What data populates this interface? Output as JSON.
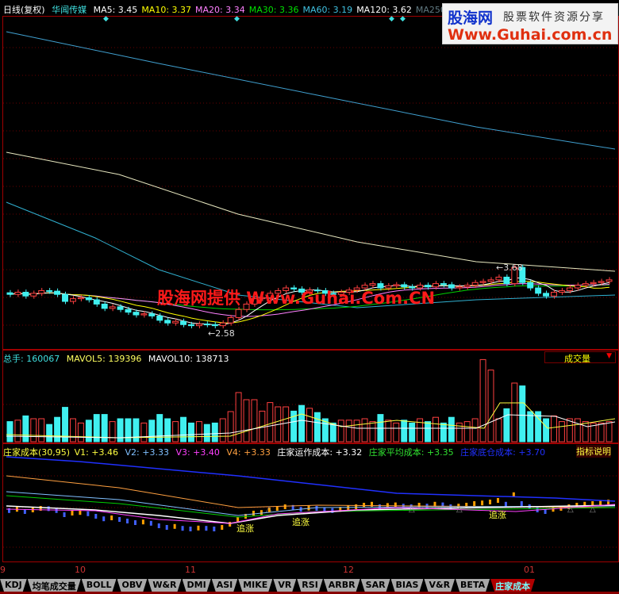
{
  "header": {
    "period": "日线(复权)",
    "stock": "华闻传媒",
    "ma": [
      {
        "label": "MA5: 3.45",
        "color": "#ffffff"
      },
      {
        "label": "MA10: 3.37",
        "color": "#ffff00"
      },
      {
        "label": "MA20: 3.34",
        "color": "#ff80ff"
      },
      {
        "label": "MA30: 3.36",
        "color": "#00e000"
      },
      {
        "label": "MA60: 3.19",
        "color": "#40c0e0"
      },
      {
        "label": "MA120: 3.62",
        "color": "#ffffff"
      },
      {
        "label": "MA250: 5.",
        "color": "#607880"
      }
    ]
  },
  "logo": {
    "name": "股海网",
    "slogan": "股票软件资源分享",
    "url": "Www.Guhai.com.cn"
  },
  "watermark": "股海网提供 Www.Guhai.Com.CN",
  "price_chart": {
    "high_label": "3.68",
    "low_label": "2.58",
    "closes": [
      3.18,
      3.22,
      3.15,
      3.2,
      3.25,
      3.24,
      3.18,
      3.05,
      3.1,
      3.12,
      3.08,
      3.0,
      2.92,
      2.95,
      2.9,
      2.85,
      2.8,
      2.82,
      2.78,
      2.7,
      2.65,
      2.68,
      2.62,
      2.6,
      2.63,
      2.62,
      2.6,
      2.65,
      2.75,
      2.9,
      3.0,
      3.1,
      3.12,
      3.2,
      3.25,
      3.3,
      3.28,
      3.22,
      3.26,
      3.25,
      3.2,
      3.18,
      3.22,
      3.26,
      3.3,
      3.35,
      3.38,
      3.3,
      3.34,
      3.36,
      3.32,
      3.3,
      3.35,
      3.32,
      3.38,
      3.36,
      3.3,
      3.32,
      3.35,
      3.4,
      3.42,
      3.45,
      3.5,
      3.38,
      3.68,
      3.4,
      3.3,
      3.2,
      3.15,
      3.22,
      3.25,
      3.3,
      3.35,
      3.38,
      3.4,
      3.42,
      3.45
    ]
  },
  "volume": {
    "total": "总手: 160067",
    "mavol5": "MAVOL5: 139396",
    "mavol10": "MAVOL10: 138713",
    "selector": "成交量"
  },
  "indicator": {
    "name": "庄家成本(30,95)",
    "v1": "V1: +3.46",
    "v2": "V2: +3.33",
    "v3": "V3: +3.40",
    "v4": "V4: +3.33",
    "op": "庄家运作成本: +3.32",
    "avg": "庄家平均成本: +3.35",
    "base": "庄家底仓成本: +3.70",
    "help": "指标说明",
    "signal": "追涨"
  },
  "x_axis": [
    "9",
    "10",
    "11",
    "12",
    "01"
  ],
  "tabs": [
    "KDJ",
    "均笔成交量",
    "BOLL",
    "OBV",
    "W&R",
    "DMI",
    "ASI",
    "MIKE",
    "VR",
    "RSI",
    "ARBR",
    "SAR",
    "BIAS",
    "V&R",
    "BETA",
    "庄家成本"
  ],
  "active_tab": "庄家成本"
}
